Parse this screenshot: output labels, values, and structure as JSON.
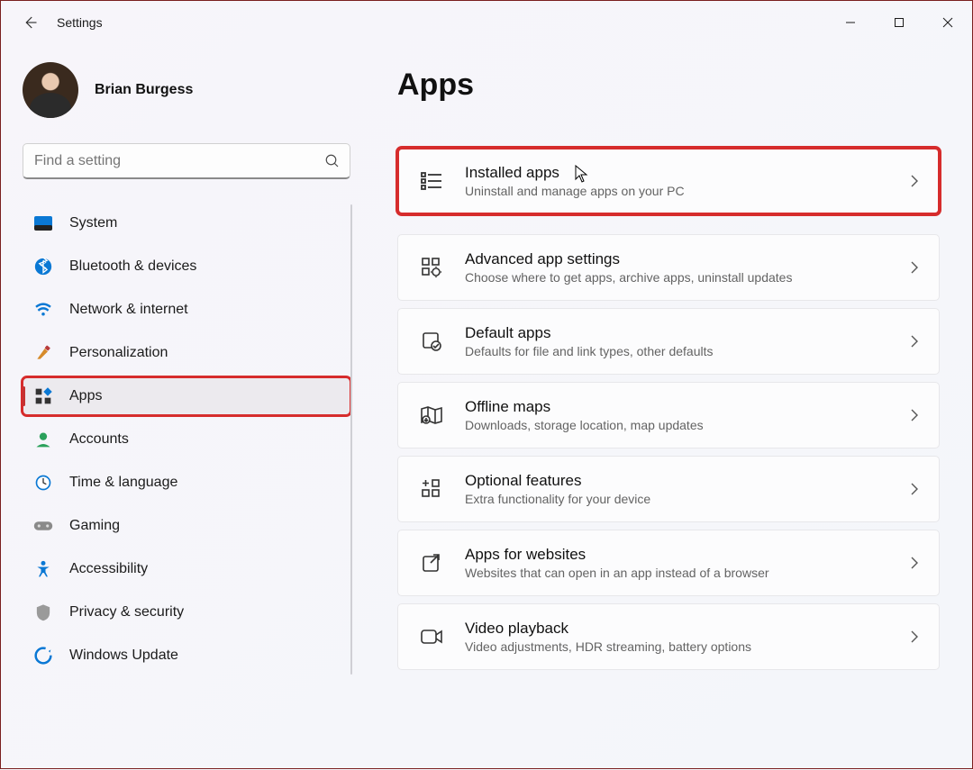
{
  "window": {
    "title": "Settings",
    "user_name": "Brian Burgess"
  },
  "search": {
    "placeholder": "Find a setting"
  },
  "nav": {
    "items": [
      {
        "label": "System",
        "icon": "system"
      },
      {
        "label": "Bluetooth & devices",
        "icon": "bluetooth"
      },
      {
        "label": "Network & internet",
        "icon": "wifi"
      },
      {
        "label": "Personalization",
        "icon": "brush"
      },
      {
        "label": "Apps",
        "icon": "apps"
      },
      {
        "label": "Accounts",
        "icon": "person"
      },
      {
        "label": "Time & language",
        "icon": "clock"
      },
      {
        "label": "Gaming",
        "icon": "gamepad"
      },
      {
        "label": "Accessibility",
        "icon": "accessibility"
      },
      {
        "label": "Privacy & security",
        "icon": "shield"
      },
      {
        "label": "Windows Update",
        "icon": "update"
      }
    ],
    "selected_index": 4
  },
  "page": {
    "heading": "Apps",
    "cards": [
      {
        "title": "Installed apps",
        "desc": "Uninstall and manage apps on your PC",
        "icon": "list",
        "highlighted": true
      },
      {
        "title": "Advanced app settings",
        "desc": "Choose where to get apps, archive apps, uninstall updates",
        "icon": "grid-gear",
        "highlighted": false
      },
      {
        "title": "Default apps",
        "desc": "Defaults for file and link types, other defaults",
        "icon": "check-box",
        "highlighted": false
      },
      {
        "title": "Offline maps",
        "desc": "Downloads, storage location, map updates",
        "icon": "map",
        "highlighted": false
      },
      {
        "title": "Optional features",
        "desc": "Extra functionality for your device",
        "icon": "plus-grid",
        "highlighted": false
      },
      {
        "title": "Apps for websites",
        "desc": "Websites that can open in an app instead of a browser",
        "icon": "link-out",
        "highlighted": false
      },
      {
        "title": "Video playback",
        "desc": "Video adjustments, HDR streaming, battery options",
        "icon": "video",
        "highlighted": false
      }
    ]
  }
}
